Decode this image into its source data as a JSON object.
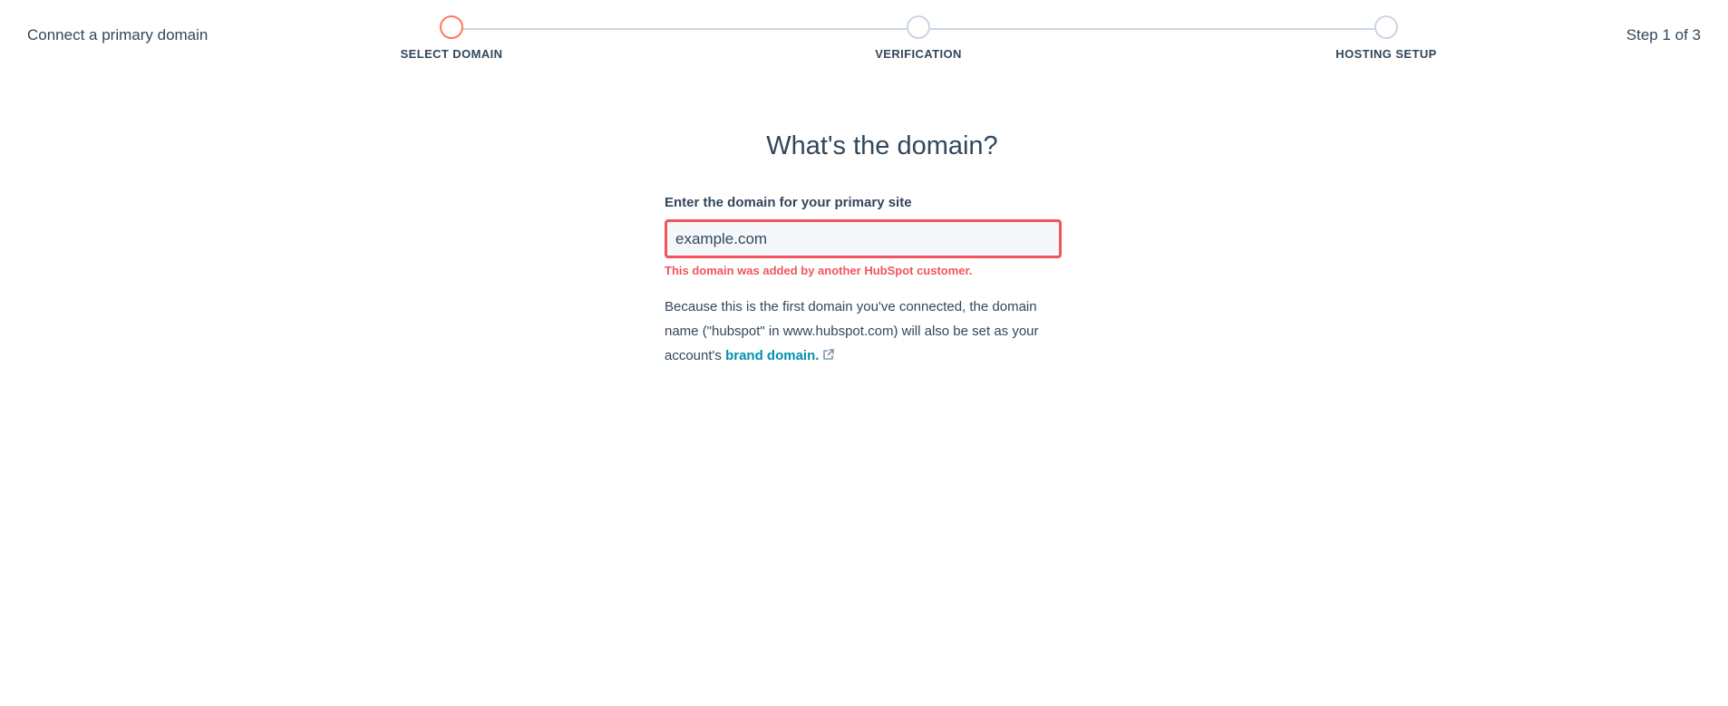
{
  "header": {
    "flow_title": "Connect a primary domain",
    "step_count": "Step 1 of 3",
    "steps": [
      {
        "label": "SELECT DOMAIN",
        "state": "active"
      },
      {
        "label": "VERIFICATION",
        "state": "pending"
      },
      {
        "label": "HOSTING SETUP",
        "state": "pending"
      }
    ]
  },
  "main": {
    "heading": "What's the domain?",
    "field_label": "Enter the domain for your primary site",
    "domain_value": "example.com",
    "error_message": "This domain was added by another HubSpot customer.",
    "help_text": "Because this is the first domain you've connected, the domain name (\"hubspot\" in www.hubspot.com) will also be set as your account's",
    "link_text": "brand domain.",
    "link_icon": "external-link-icon"
  },
  "colors": {
    "accent_active_step": "#ff7a59",
    "inactive_step": "#cbd6e2",
    "error": "#f2545b",
    "link": "#0091ae",
    "text": "#33475b",
    "input_background": "#f5f8fa"
  }
}
